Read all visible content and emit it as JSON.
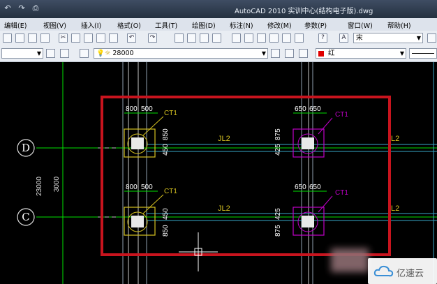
{
  "titlebar": {
    "title": "AutoCAD 2010    实训中心(结构电子版).dwg"
  },
  "menu": [
    "编辑(E)",
    "视图(V)",
    "插入(I)",
    "格式(O)",
    "工具(T)",
    "绘图(D)",
    "标注(N)",
    "修改(M)",
    "参数(P)",
    "窗口(W)",
    "帮助(H)"
  ],
  "toolbar": {
    "font_value": "宋",
    "layer_value": "28000",
    "color_value": "红"
  },
  "drawing": {
    "axes": {
      "D": "D",
      "C": "C"
    },
    "dims_left": {
      "total": "23000",
      "spacing": "3000"
    },
    "columns": [
      {
        "top": "800",
        "top2": "500",
        "side": "450",
        "side2": "850",
        "tag": "CT1"
      },
      {
        "top": "650",
        "top2": "650",
        "side": "425",
        "side2": "875",
        "tag": "CT1"
      },
      {
        "top": "800",
        "top2": "500",
        "side": "850",
        "side2": "450",
        "tag": "CT1"
      },
      {
        "top": "650",
        "top2": "650",
        "side": "875",
        "side2": "425",
        "tag": "CT1"
      }
    ],
    "beam_labels": {
      "mid_top": "JL2",
      "right_top": "L2",
      "mid_bottom": "JL2",
      "right_bottom": "L2"
    }
  },
  "watermark": {
    "text": "亿速云"
  },
  "colors": {
    "grid_green": "#00e000",
    "axis_gray": "#c8c8c8",
    "beam_cyan": "#38a8c8",
    "highlight_red": "#c8141e",
    "col_yellow": "#d4c020",
    "col_magenta": "#c000c8"
  }
}
